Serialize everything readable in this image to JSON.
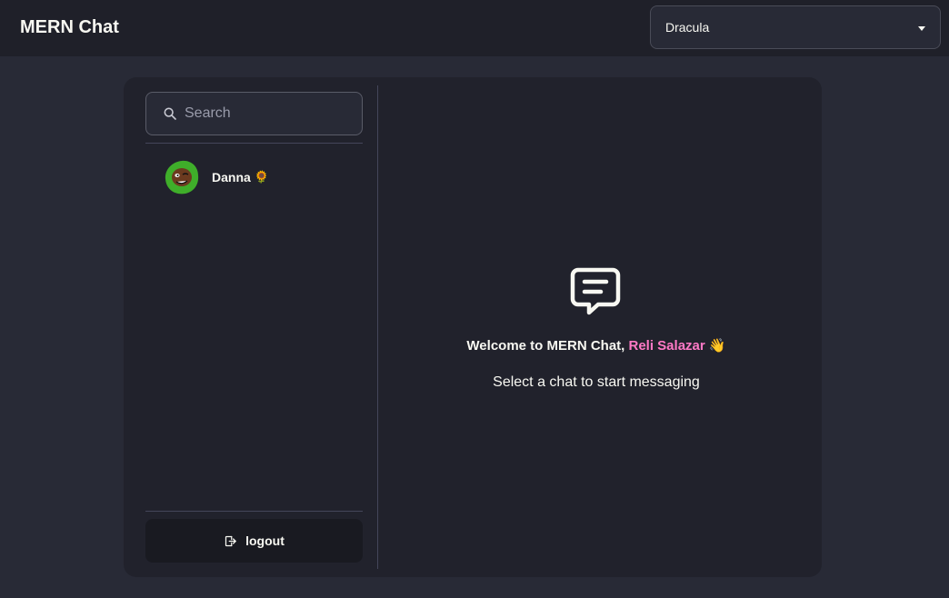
{
  "app": {
    "title": "MERN Chat"
  },
  "theme_selector": {
    "selected": "Dracula"
  },
  "sidebar": {
    "search": {
      "placeholder": "Search",
      "value": ""
    },
    "contacts": [
      {
        "name": "Danna",
        "emoji": "🌻",
        "avatar": "avatar-cartoon"
      }
    ],
    "logout_label": "logout"
  },
  "main": {
    "welcome_prefix": "Welcome to MERN Chat, ",
    "user_name": "Reli Salazar",
    "welcome_emoji": "👋",
    "subtitle": "Select a chat to start messaging"
  },
  "colors": {
    "background": "#282a36",
    "topbar": "#1f2029",
    "card": "#21222c",
    "accent_pink": "#ff79c6",
    "text": "#f8f8f2"
  }
}
